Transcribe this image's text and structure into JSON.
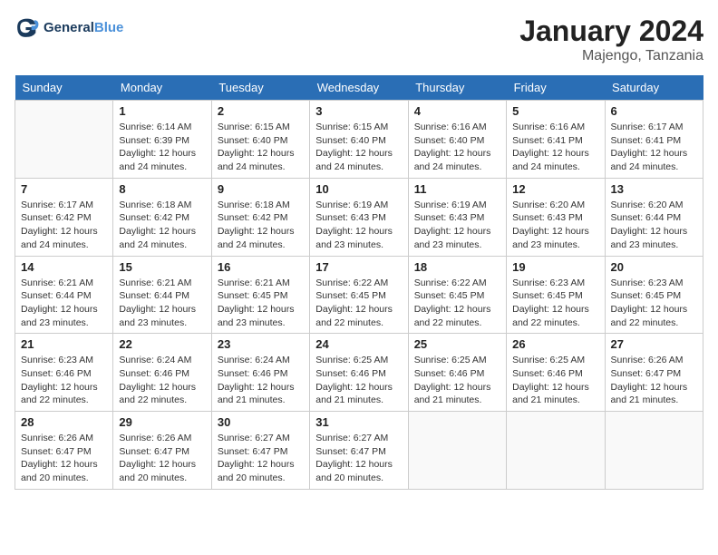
{
  "header": {
    "logo_line1": "General",
    "logo_line2": "Blue",
    "month": "January 2024",
    "location": "Majengo, Tanzania"
  },
  "days_of_week": [
    "Sunday",
    "Monday",
    "Tuesday",
    "Wednesday",
    "Thursday",
    "Friday",
    "Saturday"
  ],
  "weeks": [
    [
      {
        "day": "",
        "info": ""
      },
      {
        "day": "1",
        "info": "Sunrise: 6:14 AM\nSunset: 6:39 PM\nDaylight: 12 hours\nand 24 minutes."
      },
      {
        "day": "2",
        "info": "Sunrise: 6:15 AM\nSunset: 6:40 PM\nDaylight: 12 hours\nand 24 minutes."
      },
      {
        "day": "3",
        "info": "Sunrise: 6:15 AM\nSunset: 6:40 PM\nDaylight: 12 hours\nand 24 minutes."
      },
      {
        "day": "4",
        "info": "Sunrise: 6:16 AM\nSunset: 6:40 PM\nDaylight: 12 hours\nand 24 minutes."
      },
      {
        "day": "5",
        "info": "Sunrise: 6:16 AM\nSunset: 6:41 PM\nDaylight: 12 hours\nand 24 minutes."
      },
      {
        "day": "6",
        "info": "Sunrise: 6:17 AM\nSunset: 6:41 PM\nDaylight: 12 hours\nand 24 minutes."
      }
    ],
    [
      {
        "day": "7",
        "info": "Sunrise: 6:17 AM\nSunset: 6:42 PM\nDaylight: 12 hours\nand 24 minutes."
      },
      {
        "day": "8",
        "info": "Sunrise: 6:18 AM\nSunset: 6:42 PM\nDaylight: 12 hours\nand 24 minutes."
      },
      {
        "day": "9",
        "info": "Sunrise: 6:18 AM\nSunset: 6:42 PM\nDaylight: 12 hours\nand 24 minutes."
      },
      {
        "day": "10",
        "info": "Sunrise: 6:19 AM\nSunset: 6:43 PM\nDaylight: 12 hours\nand 23 minutes."
      },
      {
        "day": "11",
        "info": "Sunrise: 6:19 AM\nSunset: 6:43 PM\nDaylight: 12 hours\nand 23 minutes."
      },
      {
        "day": "12",
        "info": "Sunrise: 6:20 AM\nSunset: 6:43 PM\nDaylight: 12 hours\nand 23 minutes."
      },
      {
        "day": "13",
        "info": "Sunrise: 6:20 AM\nSunset: 6:44 PM\nDaylight: 12 hours\nand 23 minutes."
      }
    ],
    [
      {
        "day": "14",
        "info": "Sunrise: 6:21 AM\nSunset: 6:44 PM\nDaylight: 12 hours\nand 23 minutes."
      },
      {
        "day": "15",
        "info": "Sunrise: 6:21 AM\nSunset: 6:44 PM\nDaylight: 12 hours\nand 23 minutes."
      },
      {
        "day": "16",
        "info": "Sunrise: 6:21 AM\nSunset: 6:45 PM\nDaylight: 12 hours\nand 23 minutes."
      },
      {
        "day": "17",
        "info": "Sunrise: 6:22 AM\nSunset: 6:45 PM\nDaylight: 12 hours\nand 22 minutes."
      },
      {
        "day": "18",
        "info": "Sunrise: 6:22 AM\nSunset: 6:45 PM\nDaylight: 12 hours\nand 22 minutes."
      },
      {
        "day": "19",
        "info": "Sunrise: 6:23 AM\nSunset: 6:45 PM\nDaylight: 12 hours\nand 22 minutes."
      },
      {
        "day": "20",
        "info": "Sunrise: 6:23 AM\nSunset: 6:45 PM\nDaylight: 12 hours\nand 22 minutes."
      }
    ],
    [
      {
        "day": "21",
        "info": "Sunrise: 6:23 AM\nSunset: 6:46 PM\nDaylight: 12 hours\nand 22 minutes."
      },
      {
        "day": "22",
        "info": "Sunrise: 6:24 AM\nSunset: 6:46 PM\nDaylight: 12 hours\nand 22 minutes."
      },
      {
        "day": "23",
        "info": "Sunrise: 6:24 AM\nSunset: 6:46 PM\nDaylight: 12 hours\nand 21 minutes."
      },
      {
        "day": "24",
        "info": "Sunrise: 6:25 AM\nSunset: 6:46 PM\nDaylight: 12 hours\nand 21 minutes."
      },
      {
        "day": "25",
        "info": "Sunrise: 6:25 AM\nSunset: 6:46 PM\nDaylight: 12 hours\nand 21 minutes."
      },
      {
        "day": "26",
        "info": "Sunrise: 6:25 AM\nSunset: 6:46 PM\nDaylight: 12 hours\nand 21 minutes."
      },
      {
        "day": "27",
        "info": "Sunrise: 6:26 AM\nSunset: 6:47 PM\nDaylight: 12 hours\nand 21 minutes."
      }
    ],
    [
      {
        "day": "28",
        "info": "Sunrise: 6:26 AM\nSunset: 6:47 PM\nDaylight: 12 hours\nand 20 minutes."
      },
      {
        "day": "29",
        "info": "Sunrise: 6:26 AM\nSunset: 6:47 PM\nDaylight: 12 hours\nand 20 minutes."
      },
      {
        "day": "30",
        "info": "Sunrise: 6:27 AM\nSunset: 6:47 PM\nDaylight: 12 hours\nand 20 minutes."
      },
      {
        "day": "31",
        "info": "Sunrise: 6:27 AM\nSunset: 6:47 PM\nDaylight: 12 hours\nand 20 minutes."
      },
      {
        "day": "",
        "info": ""
      },
      {
        "day": "",
        "info": ""
      },
      {
        "day": "",
        "info": ""
      }
    ]
  ]
}
